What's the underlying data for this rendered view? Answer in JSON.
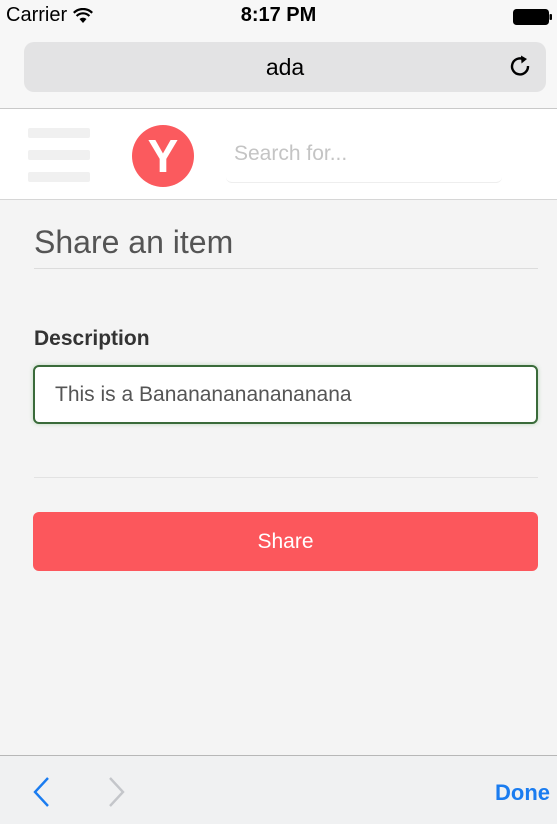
{
  "status_bar": {
    "carrier": "Carrier",
    "time": "8:17 PM"
  },
  "browser": {
    "address": "ada"
  },
  "header": {
    "logo_letter": "Y",
    "search_placeholder": "Search for...",
    "brand_color": "#fb5a5e"
  },
  "form": {
    "title": "Share an item",
    "description_label": "Description",
    "description_value": "This is a Banananananananana",
    "share_label": "Share",
    "share_color": "#fc575c"
  },
  "accessory": {
    "done_label": "Done",
    "accent_color": "#1a7cf0"
  },
  "icons": [
    "wifi-icon",
    "battery-icon",
    "reload-icon",
    "hamburger-icon",
    "chevron-left-icon",
    "chevron-right-icon"
  ]
}
